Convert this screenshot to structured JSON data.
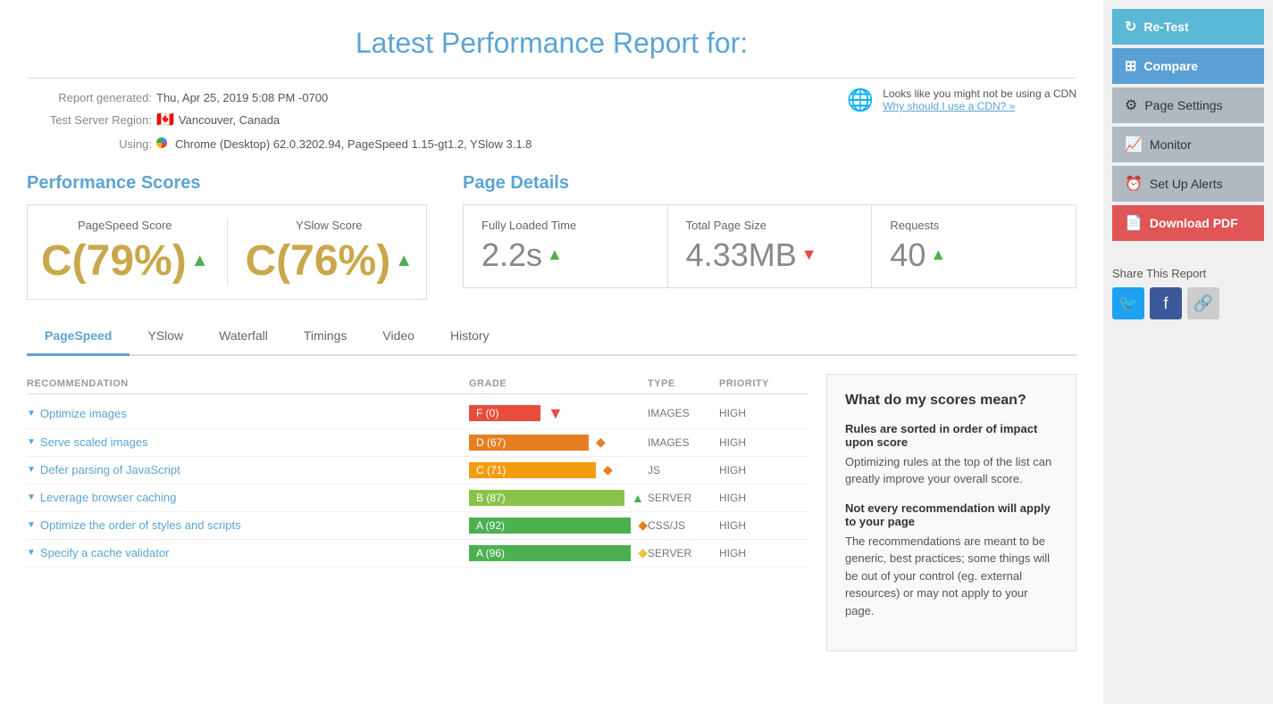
{
  "page": {
    "title": "Latest Performance Report for:"
  },
  "report": {
    "generated_label": "Report generated:",
    "generated_value": "Thu, Apr 25, 2019 5:08 PM -0700",
    "region_label": "Test Server Region:",
    "region_flag": "🇨🇦",
    "region_value": "Vancouver, Canada",
    "using_label": "Using:",
    "using_value": "Chrome (Desktop) 62.0.3202.94, PageSpeed 1.15-gt1.2, YSlow 3.1.8",
    "cdn_warning": "Looks like you might not be using a CDN",
    "cdn_link": "Why should I use a CDN? »"
  },
  "performance_scores": {
    "title": "Performance Scores",
    "pagespeed": {
      "label": "PageSpeed Score",
      "value": "C(79%)",
      "arrow": "▲"
    },
    "yslow": {
      "label": "YSlow Score",
      "value": "C(76%)",
      "arrow": "▲"
    }
  },
  "page_details": {
    "title": "Page Details",
    "fully_loaded": {
      "label": "Fully Loaded Time",
      "value": "2.2s",
      "arrow": "▲",
      "arrow_type": "up"
    },
    "total_size": {
      "label": "Total Page Size",
      "value": "4.33MB",
      "arrow": "▼",
      "arrow_type": "down"
    },
    "requests": {
      "label": "Requests",
      "value": "40",
      "arrow": "▲",
      "arrow_type": "up"
    }
  },
  "tabs": [
    {
      "id": "pagespeed",
      "label": "PageSpeed",
      "active": true
    },
    {
      "id": "yslow",
      "label": "YSlow",
      "active": false
    },
    {
      "id": "waterfall",
      "label": "Waterfall",
      "active": false
    },
    {
      "id": "timings",
      "label": "Timings",
      "active": false
    },
    {
      "id": "video",
      "label": "Video",
      "active": false
    },
    {
      "id": "history",
      "label": "History",
      "active": false
    }
  ],
  "table": {
    "headers": {
      "recommendation": "Recommendation",
      "grade": "Grade",
      "type": "Type",
      "priority": "Priority"
    },
    "rows": [
      {
        "name": "Optimize images",
        "grade": "F (0)",
        "grade_class": "f",
        "grade_pct": 0,
        "icon": "▼",
        "icon_type": "red-down",
        "type": "IMAGES",
        "priority": "HIGH"
      },
      {
        "name": "Serve scaled images",
        "grade": "D (67)",
        "grade_class": "d",
        "grade_pct": 67,
        "icon": "◆",
        "icon_type": "orange-diamond",
        "type": "IMAGES",
        "priority": "HIGH"
      },
      {
        "name": "Defer parsing of JavaScript",
        "grade": "C (71)",
        "grade_class": "c",
        "grade_pct": 71,
        "icon": "◆",
        "icon_type": "orange-diamond",
        "type": "JS",
        "priority": "HIGH"
      },
      {
        "name": "Leverage browser caching",
        "grade": "B (87)",
        "grade_class": "b",
        "grade_pct": 87,
        "icon": "▲",
        "icon_type": "green-up",
        "type": "SERVER",
        "priority": "HIGH"
      },
      {
        "name": "Optimize the order of styles and scripts",
        "grade": "A (92)",
        "grade_class": "a",
        "grade_pct": 92,
        "icon": "◆",
        "icon_type": "orange-diamond",
        "type": "CSS/JS",
        "priority": "HIGH"
      },
      {
        "name": "Specify a cache validator",
        "grade": "A (96)",
        "grade_class": "a",
        "grade_pct": 96,
        "icon": "◆",
        "icon_type": "yellow-diamond",
        "type": "SERVER",
        "priority": "HIGH"
      }
    ]
  },
  "info_box": {
    "title": "What do my scores mean?",
    "section1_title": "Rules are sorted in order of impact upon score",
    "section1_text": "Optimizing rules at the top of the list can greatly improve your overall score.",
    "section2_title": "Not every recommendation will apply to your page",
    "section2_text": "The recommendations are meant to be generic, best practices; some things will be out of your control (eg. external resources) or may not apply to your page."
  },
  "sidebar": {
    "retest_label": "Re-Test",
    "compare_label": "Compare",
    "page_settings_label": "Page Settings",
    "monitor_label": "Monitor",
    "setup_alerts_label": "Set Up Alerts",
    "download_pdf_label": "Download PDF",
    "share_title": "Share This Report"
  }
}
